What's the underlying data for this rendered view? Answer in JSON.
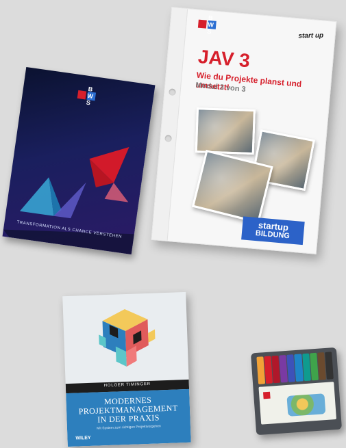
{
  "brochure": {
    "logo_text": "B W S",
    "caption": "TRANSFORMATION ALS CHANCE VERSTEHEN"
  },
  "folder": {
    "logo_text": "B W S",
    "brand_right": "start up",
    "title": "JAV 3",
    "subtitle": "Wie du Projekte planst und umsetzt!",
    "module": "Modul 3 von 3",
    "startup_top": "startup",
    "startup_bottom": "BILDUNG"
  },
  "book": {
    "author": "HOLGER TIMINGER",
    "title_line1": "MODERNES",
    "title_line2": "PROJEKTMANAGEMENT",
    "title_line3": "IN DER PRAXIS",
    "tagline": "Mit System zum richtigen Projektvorgehen",
    "publisher": "WILEY"
  },
  "colors": {
    "background": "#dcdcdc",
    "bws_red": "#d61f2b",
    "bws_blue": "#2b6ed2",
    "startup_blue": "#2c62c8",
    "book_blue": "#2d7fbd"
  }
}
